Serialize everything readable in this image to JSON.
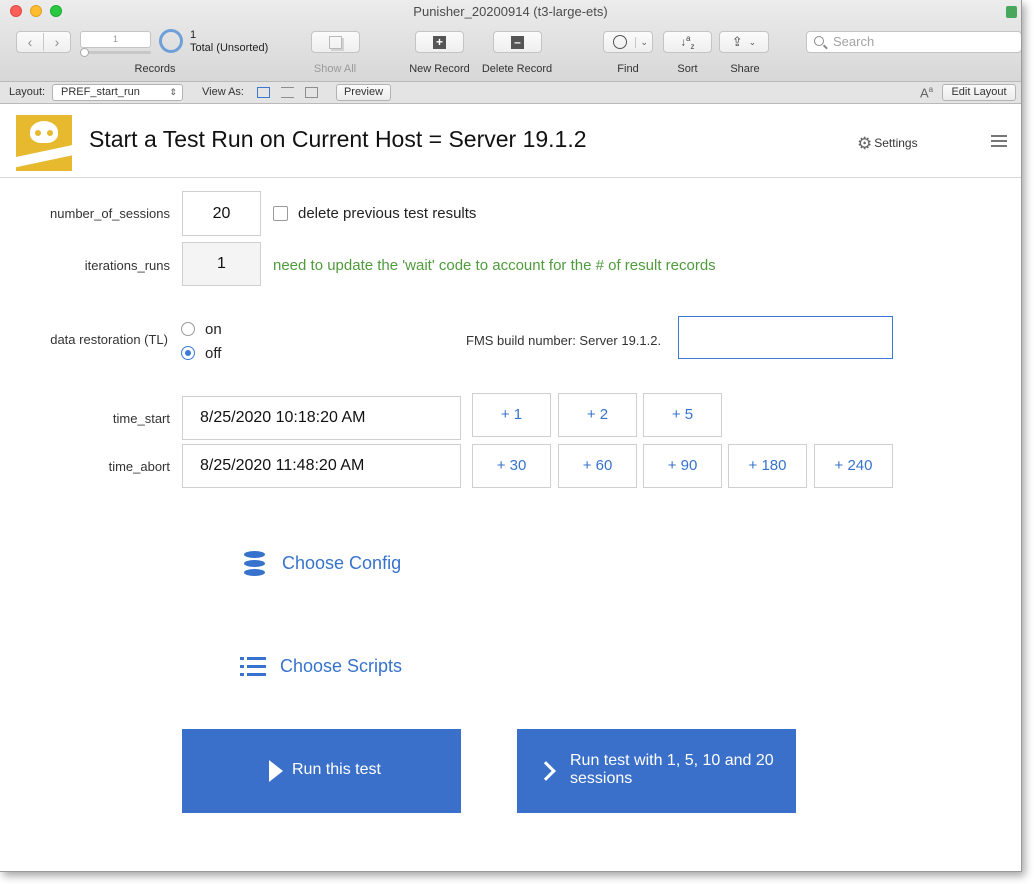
{
  "window": {
    "title": "Punisher_20200914 (t3-large-ets)"
  },
  "toolbar": {
    "record_number": "1",
    "record_total": "1",
    "record_status": "Total (Unsorted)",
    "records_label": "Records",
    "show_all_label": "Show All",
    "new_record_label": "New Record",
    "delete_record_label": "Delete Record",
    "find_label": "Find",
    "sort_label": "Sort",
    "share_label": "Share",
    "search_placeholder": "Search"
  },
  "layout_bar": {
    "layout_label": "Layout:",
    "layout_value": "PREF_start_run",
    "view_as_label": "View As:",
    "preview_label": "Preview",
    "edit_layout_label": "Edit Layout"
  },
  "header": {
    "title": "Start a Test Run on Current Host = Server 19.1.2",
    "settings_label": "Settings"
  },
  "form": {
    "sessions_label": "number_of_sessions",
    "sessions_value": "20",
    "delete_results_label": "delete previous test results",
    "iterations_label": "iterations_runs",
    "iterations_value": "1",
    "iterations_note": "need to update the 'wait' code to account for the # of result records",
    "restoration_label": "data restoration (TL)",
    "restoration_on": "on",
    "restoration_off": "off",
    "restoration_selected": "off",
    "fms_build_label": "FMS build number: Server 19.1.2.",
    "fms_build_value": "",
    "time_start_label": "time_start",
    "time_start_value": "8/25/2020 10:18:20 AM",
    "time_abort_label": "time_abort",
    "time_abort_value": "8/25/2020 11:48:20 AM",
    "start_increments": [
      "+ 1",
      "+ 2",
      "+ 5"
    ],
    "abort_increments": [
      "+ 30",
      "+ 60",
      "+ 90",
      "+ 180",
      "+ 240"
    ]
  },
  "actions": {
    "choose_config": "Choose Config",
    "choose_scripts": "Choose Scripts",
    "run_test": "Run this test",
    "run_multi": "Run test with 1, 5, 10 and 20 sessions"
  },
  "colors": {
    "accent": "#3773cc",
    "button_fill": "#3a70c9",
    "note_green": "#4f9b3c",
    "logo_yellow": "#e6b92f"
  }
}
